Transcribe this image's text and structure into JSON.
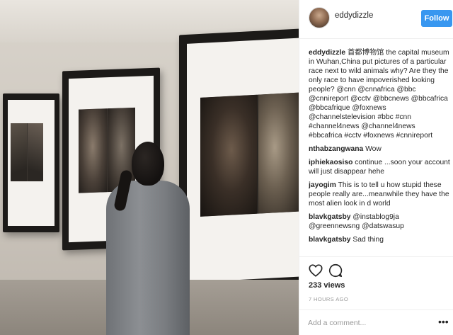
{
  "post": {
    "username": "eddydizzle",
    "follow_label": "Follow",
    "caption": {
      "user": "eddydizzle",
      "text": "首都博物馆 the capital museum in Wuhan,China put pictures of a particular race next to wild animals why? Are they the only race to have impoverished looking people? @cnn @cnnafrica @bbc @cnnireport @cctv @bbcnews @bbcafrica @bbcafrique @foxnews @channelstelevision #bbc #cnn #channel4news @channel4news #bbcafrica #cctv #foxnews #cnnireport"
    },
    "comments": [
      {
        "user": "nthabzangwana",
        "text": "Wow"
      },
      {
        "user": "iphiekaosiso",
        "text": "continue ...soon your account will just disappear hehe"
      },
      {
        "user": "jayogim",
        "text": "This is to tell u how stupid these people really are...meanwhile they have the most alien look in d world"
      },
      {
        "user": "blavkgatsby",
        "text": "@instablog9ja @greennewsng @datswasup"
      },
      {
        "user": "blavkgatsby",
        "text": "Sad thing"
      }
    ],
    "likes": "233 views",
    "time": "7 HOURS AGO",
    "add_comment_placeholder": "Add a comment...",
    "more_label": "•••",
    "icons": [
      "heart-icon",
      "comment-icon",
      "more-options-icon"
    ]
  }
}
